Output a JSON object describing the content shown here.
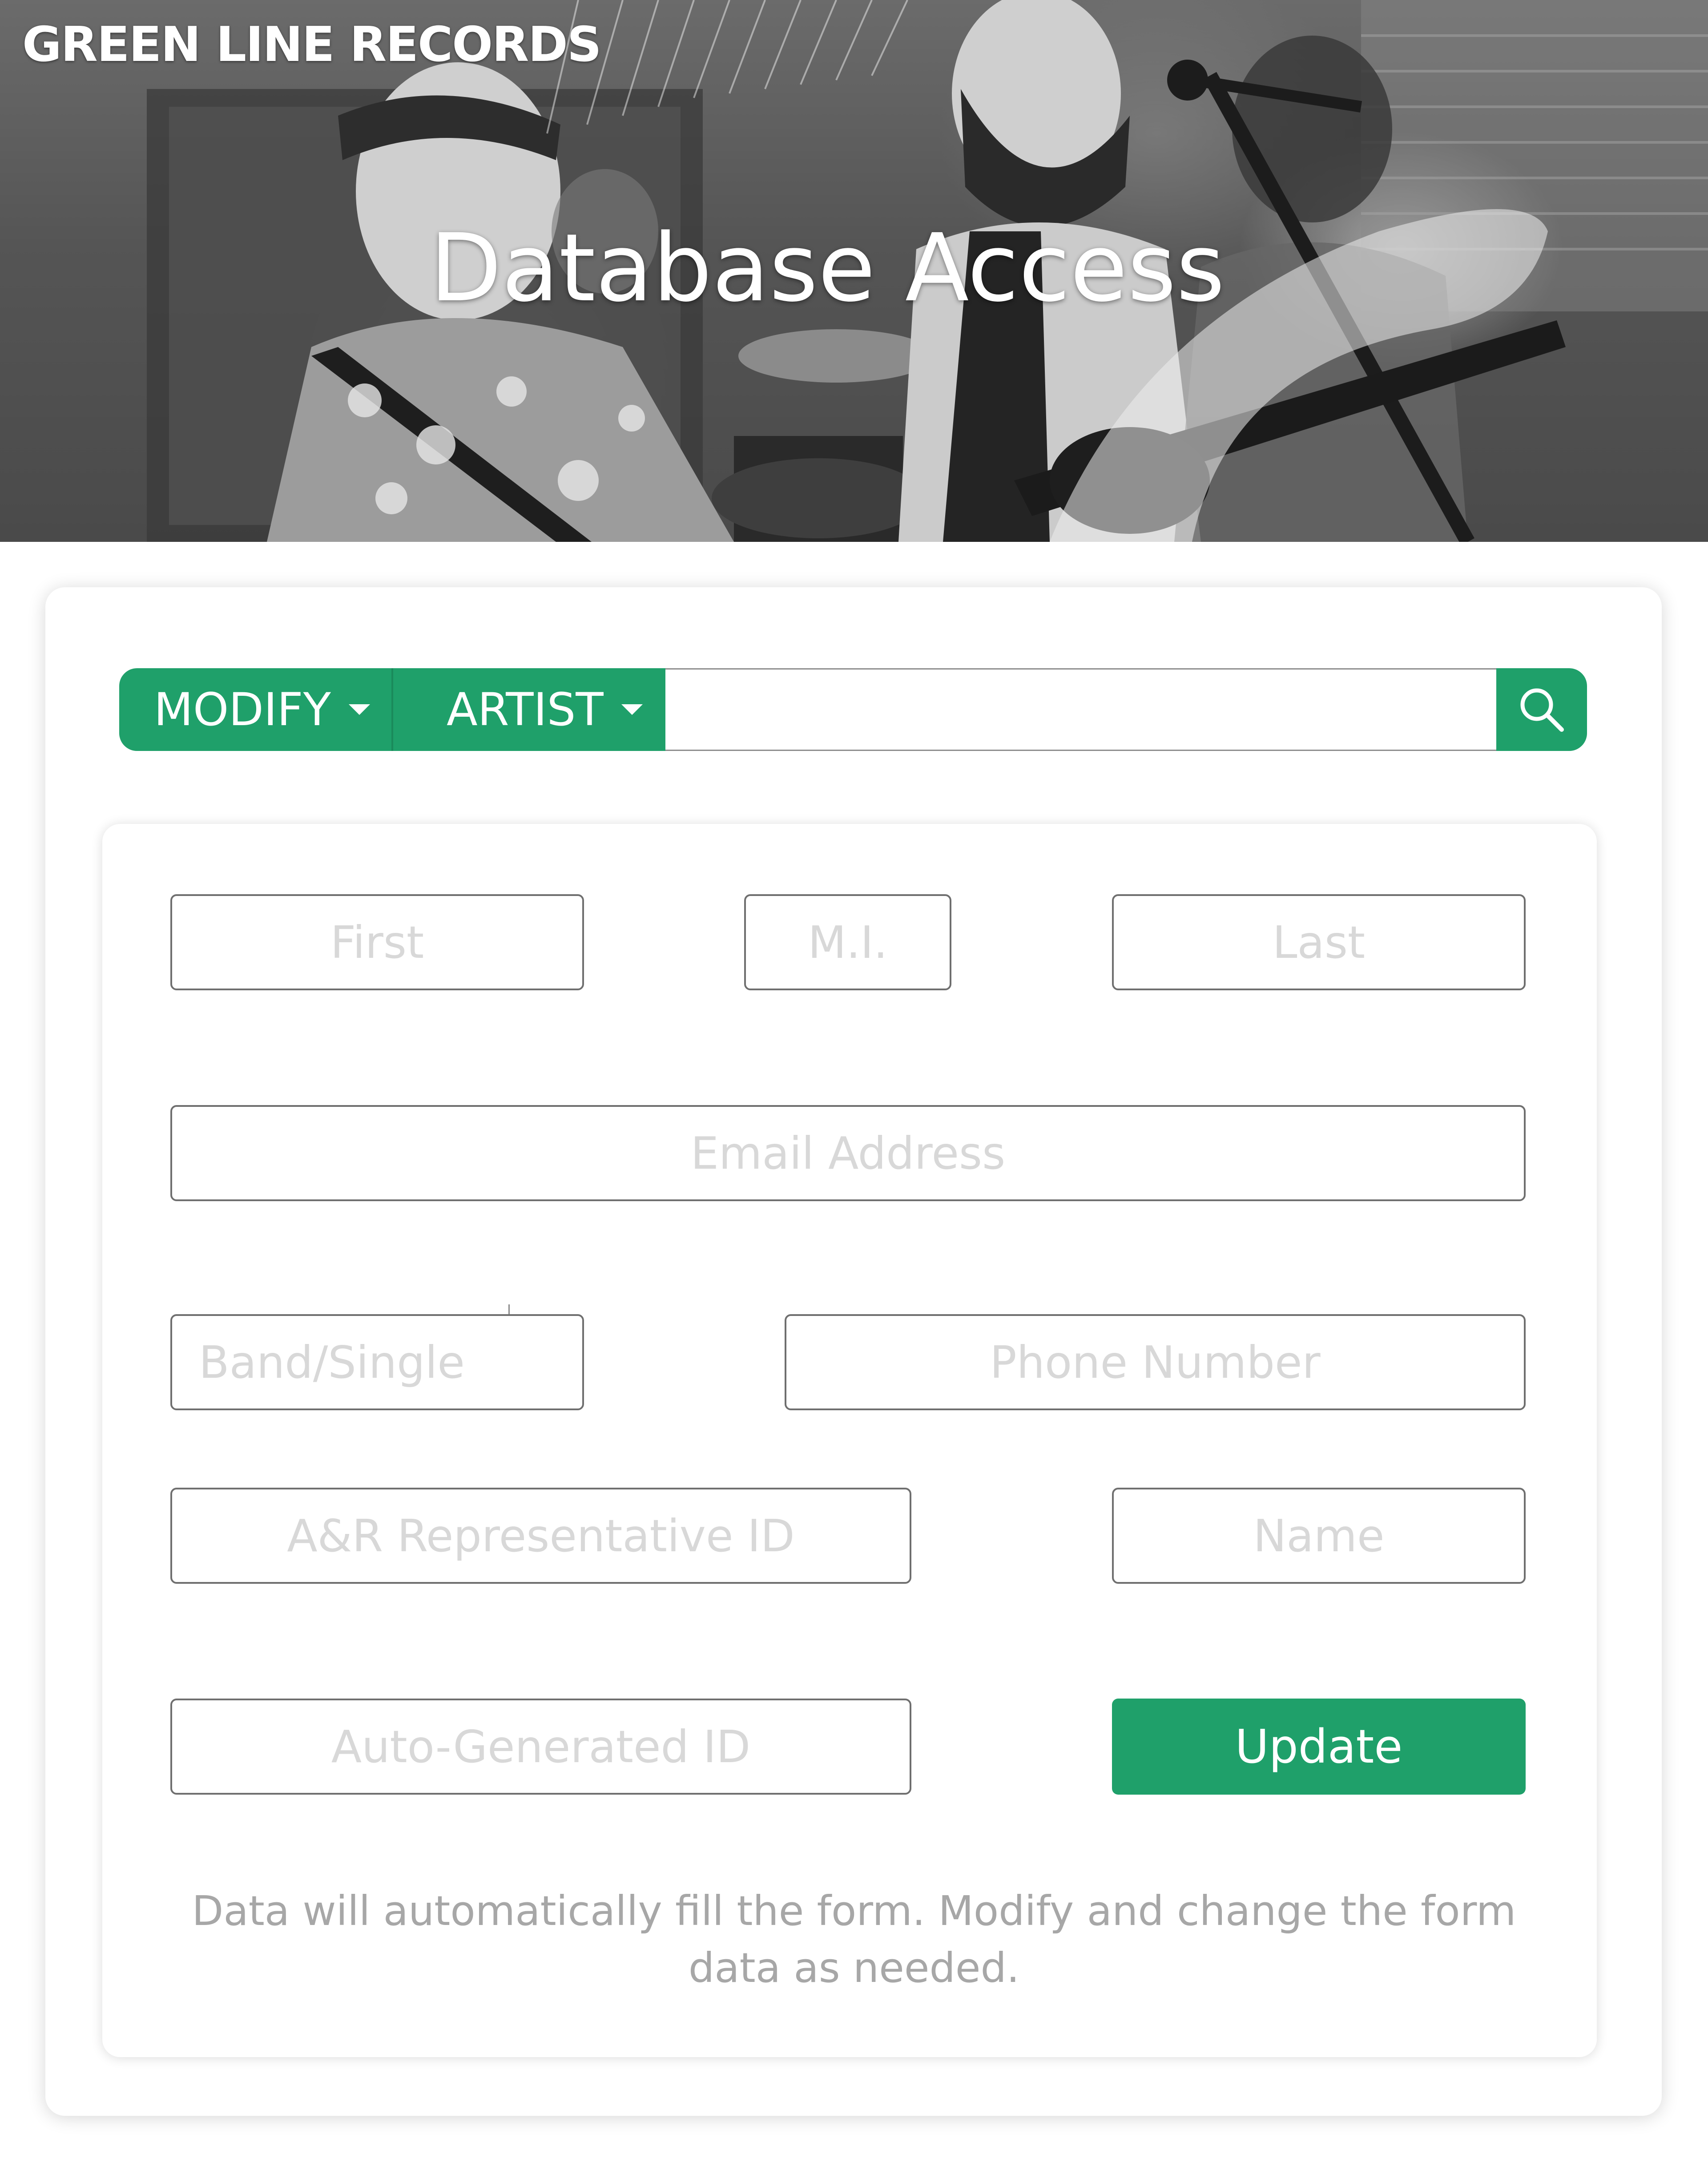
{
  "header": {
    "brand": "GREEN LINE RECORDS",
    "title": "Database Access"
  },
  "search": {
    "action_label": "MODIFY",
    "entity_label": "ARTIST",
    "value": "",
    "placeholder": ""
  },
  "form": {
    "first_placeholder": "First",
    "mi_placeholder": "M.I.",
    "last_placeholder": "Last",
    "email_placeholder": "Email Address",
    "band_placeholder": "Band/Single",
    "phone_placeholder": "Phone Number",
    "ar_id_placeholder": "A&R Representative ID",
    "name_placeholder": "Name",
    "auto_id_placeholder": "Auto-Generated ID",
    "update_label": "Update",
    "note": "Data will automatically fill the form. Modify and change the form data as needed."
  },
  "colors": {
    "accent": "#1fa06a",
    "placeholder": "#d8d8d8",
    "note_text": "#a7a7a7"
  },
  "icons": {
    "search": "search-icon",
    "dropdown": "chevron-down-icon"
  }
}
